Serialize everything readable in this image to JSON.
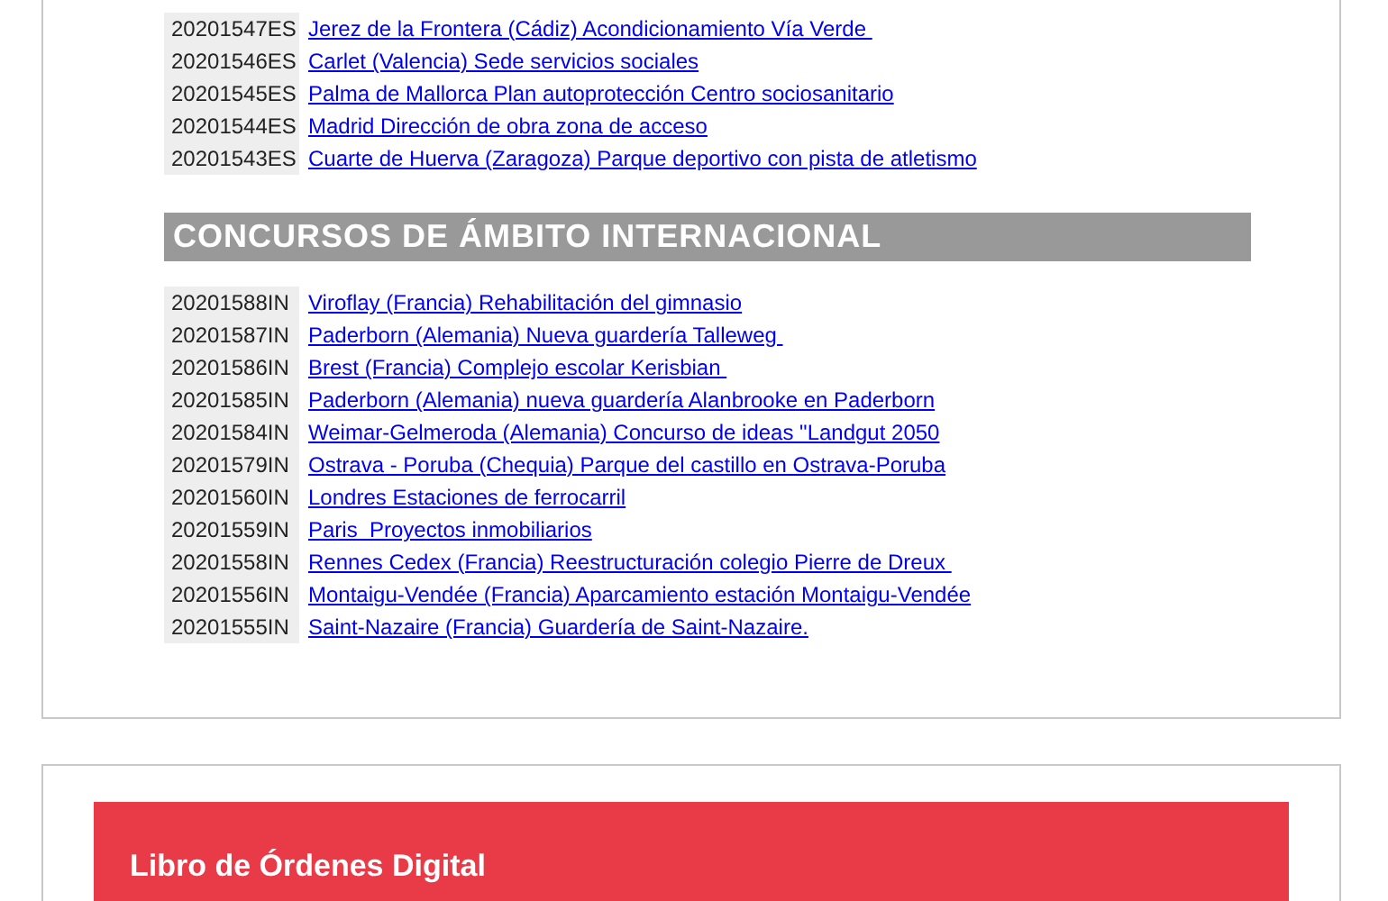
{
  "national_list": [
    {
      "code": "20201547ES",
      "title": "Jerez de la Frontera (Cádiz) Acondicionamiento Vía Verde "
    },
    {
      "code": "20201546ES",
      "title": "Carlet (Valencia) Sede servicios sociales"
    },
    {
      "code": "20201545ES",
      "title": "Palma de Mallorca Plan autoprotección Centro sociosanitario"
    },
    {
      "code": "20201544ES",
      "title": "Madrid Dirección de obra zona de acceso"
    },
    {
      "code": "20201543ES",
      "title": "Cuarte de Huerva (Zaragoza) Parque deportivo con pista de atletismo"
    }
  ],
  "international_heading": "CONCURSOS DE ÁMBITO INTERNACIONAL",
  "international_list": [
    {
      "code": "20201588IN",
      "title": "Viroflay (Francia) Rehabilitación del gimnasio"
    },
    {
      "code": "20201587IN",
      "title": "Paderborn (Alemania) Nueva guardería Talleweg "
    },
    {
      "code": "20201586IN",
      "title": "Brest (Francia) Complejo escolar Kerisbian "
    },
    {
      "code": "20201585IN",
      "title": "Paderborn (Alemania) nueva guardería Alanbrooke en Paderborn"
    },
    {
      "code": "20201584IN",
      "title": "Weimar-Gelmeroda (Alemania) Concurso de ideas \"Landgut 2050"
    },
    {
      "code": "20201579IN",
      "title": "Ostrava - Poruba (Chequia) Parque del castillo en Ostrava-Poruba"
    },
    {
      "code": "20201560IN",
      "title": "Londres Estaciones de ferrocarril"
    },
    {
      "code": "20201559IN",
      "title": "Paris  Proyectos inmobiliarios"
    },
    {
      "code": "20201558IN",
      "title": "Rennes Cedex (Francia) Reestructuración colegio Pierre de Dreux "
    },
    {
      "code": "20201556IN",
      "title": "Montaigu-Vendée (Francia) Aparcamiento estación Montaigu-Vendée"
    },
    {
      "code": "20201555IN",
      "title": "Saint-Nazaire (Francia) Guardería de Saint-Nazaire."
    }
  ],
  "banner": {
    "title_lines": [
      "Libro de Órdenes Digital"
    ]
  }
}
